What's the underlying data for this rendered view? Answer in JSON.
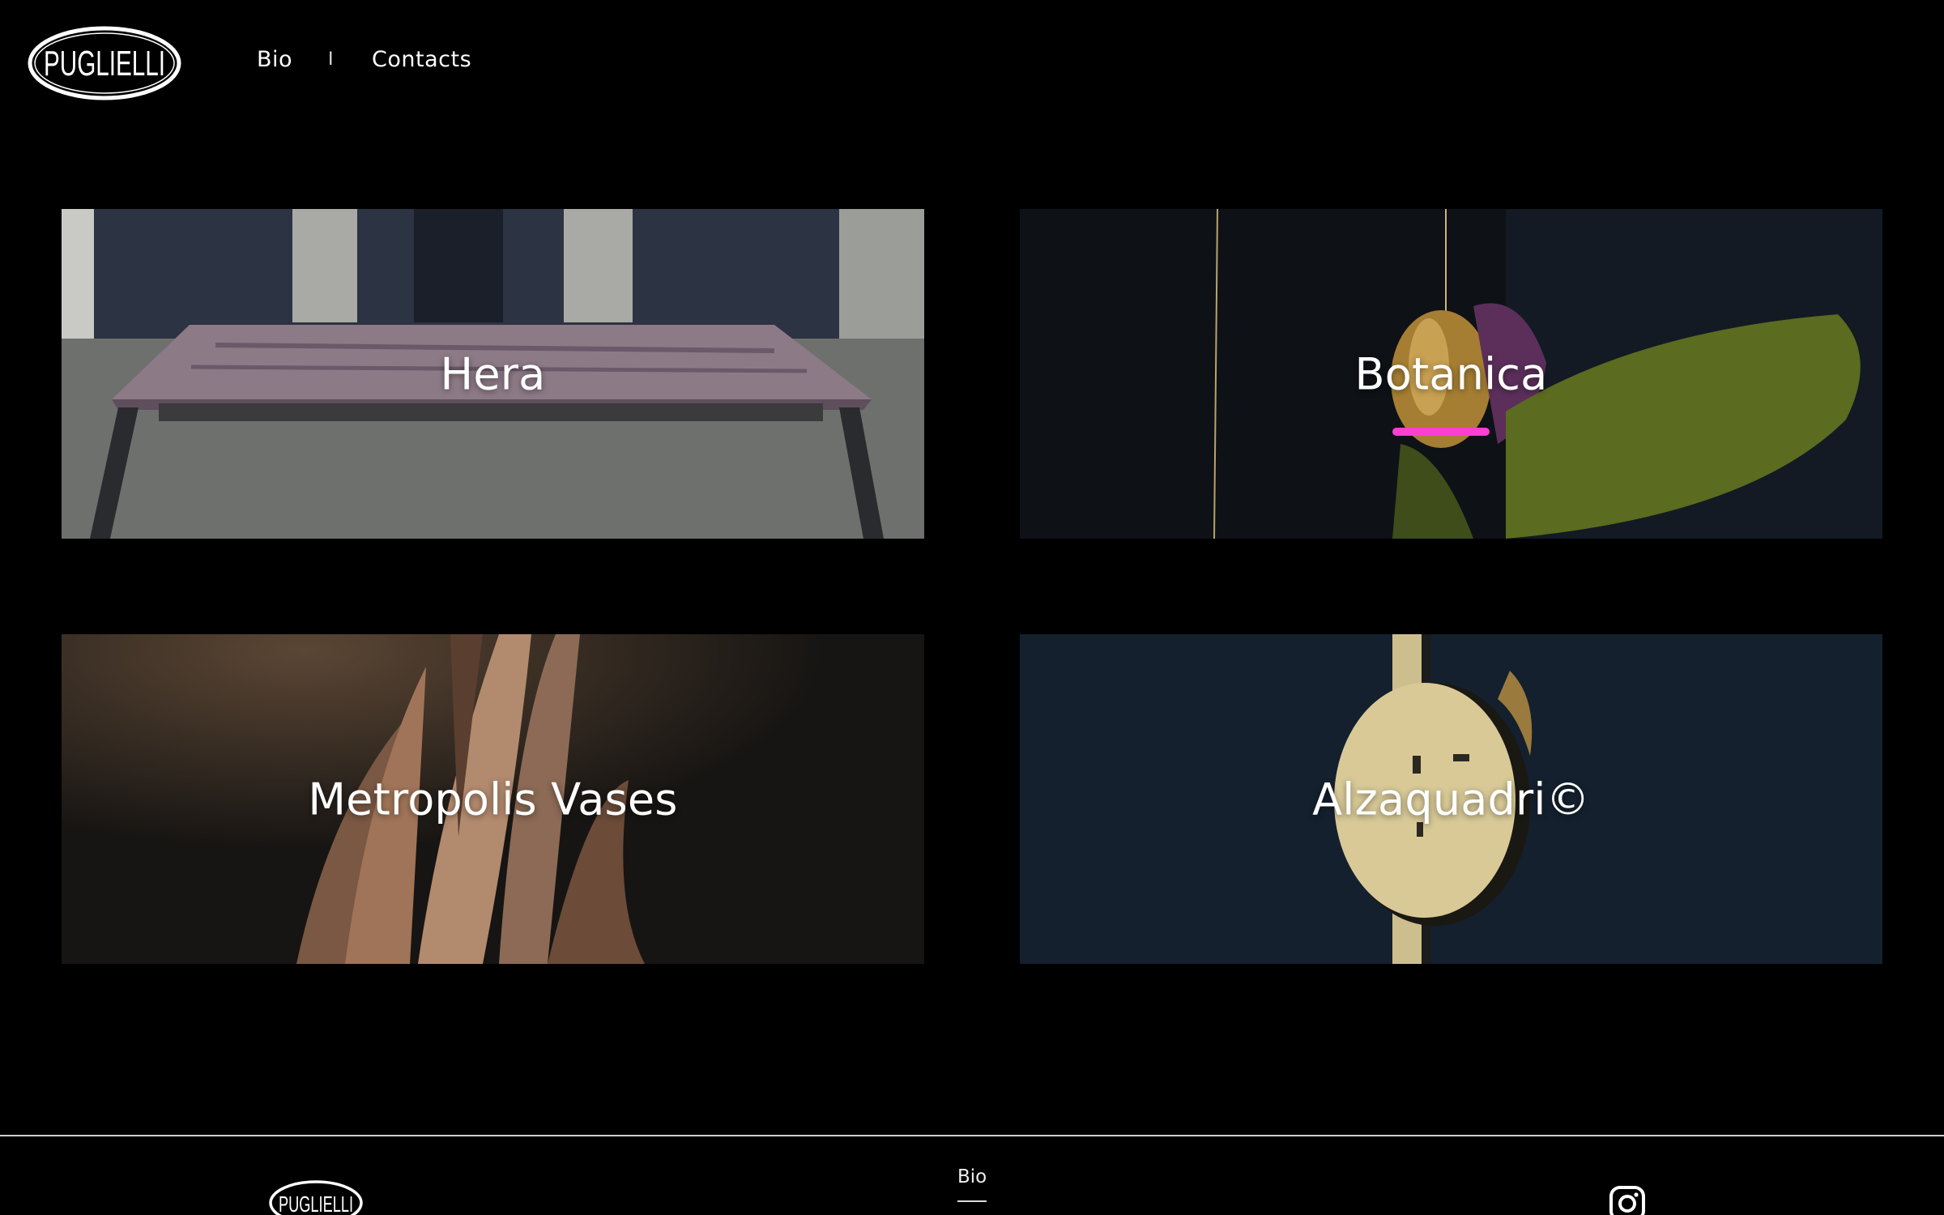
{
  "brand": {
    "logo_text": "PUGLIELLI"
  },
  "nav": {
    "bio": "Bio",
    "separator": "I",
    "contacts": "Contacts"
  },
  "projects": [
    {
      "title": "Hera"
    },
    {
      "title": "Botanica"
    },
    {
      "title": "Metropolis Vases"
    },
    {
      "title": "Alzaquadri©"
    }
  ],
  "footer": {
    "bio": "Bio",
    "social_icon": "instagram-icon"
  },
  "colors": {
    "background": "#000000",
    "text": "#ffffff",
    "accent_pink": "#ff3fd0"
  }
}
